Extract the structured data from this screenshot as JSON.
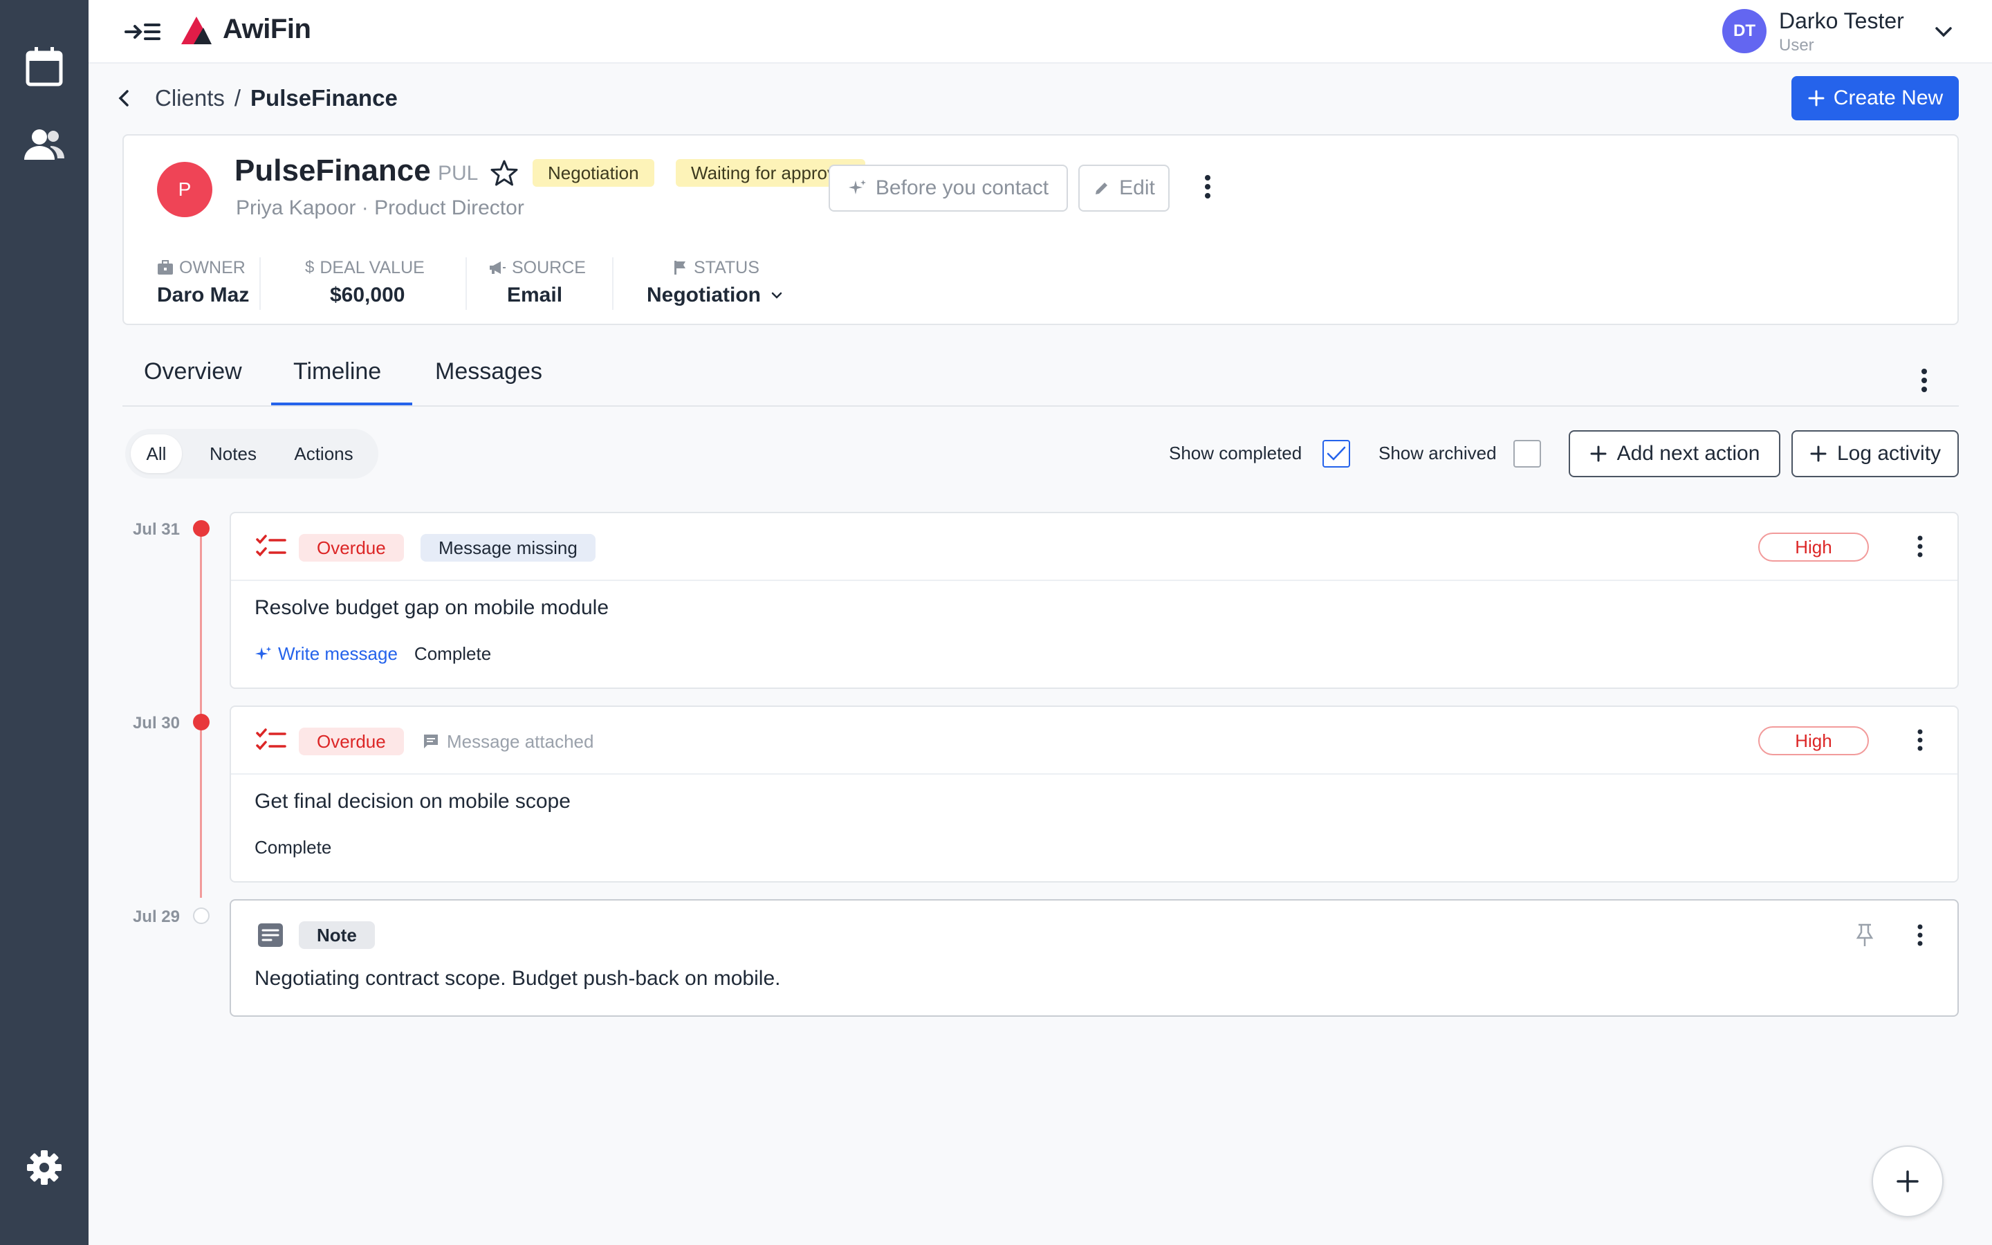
{
  "app": {
    "name": "AwiFin"
  },
  "user": {
    "initials": "DT",
    "name": "Darko Tester",
    "role": "User"
  },
  "breadcrumb": {
    "parent": "Clients",
    "separator": "/",
    "current": "PulseFinance"
  },
  "header": {
    "create_label": "Create New"
  },
  "client": {
    "initial": "P",
    "name": "PulseFinance",
    "code": "PUL",
    "tags": [
      "Negotiation",
      "Waiting for approval"
    ],
    "contact": "Priya Kapoor · Product Director",
    "actions": {
      "before_contact": "Before you contact",
      "edit": "Edit"
    },
    "stats": {
      "owner": {
        "label": "OWNER",
        "value": "Daro Maz"
      },
      "deal": {
        "label": "DEAL VALUE",
        "value": "$60,000"
      },
      "source": {
        "label": "SOURCE",
        "value": "Email"
      },
      "status": {
        "label": "STATUS",
        "value": "Negotiation"
      }
    }
  },
  "tabs": [
    "Overview",
    "Timeline",
    "Messages"
  ],
  "filters": {
    "segments": [
      "All",
      "Notes",
      "Actions"
    ],
    "show_completed": "Show completed",
    "show_archived": "Show archived",
    "add_next_action": "Add next action",
    "log_activity": "Log activity"
  },
  "timeline": [
    {
      "date": "Jul 31",
      "status": "Overdue",
      "message_badge": "Message missing",
      "priority": "High",
      "title": "Resolve budget gap on mobile module",
      "write_message": "Write message",
      "complete": "Complete"
    },
    {
      "date": "Jul 30",
      "status": "Overdue",
      "message_badge": "Message attached",
      "priority": "High",
      "title": "Get final decision on mobile scope",
      "complete": "Complete"
    },
    {
      "date": "Jul 29",
      "type": "Note",
      "text": "Negotiating contract scope. Budget push-back on mobile."
    }
  ],
  "colors": {
    "accent": "#2563eb",
    "sidebar": "#354050",
    "danger": "#dc2626",
    "tag_yellow": "#fdf3b8"
  }
}
